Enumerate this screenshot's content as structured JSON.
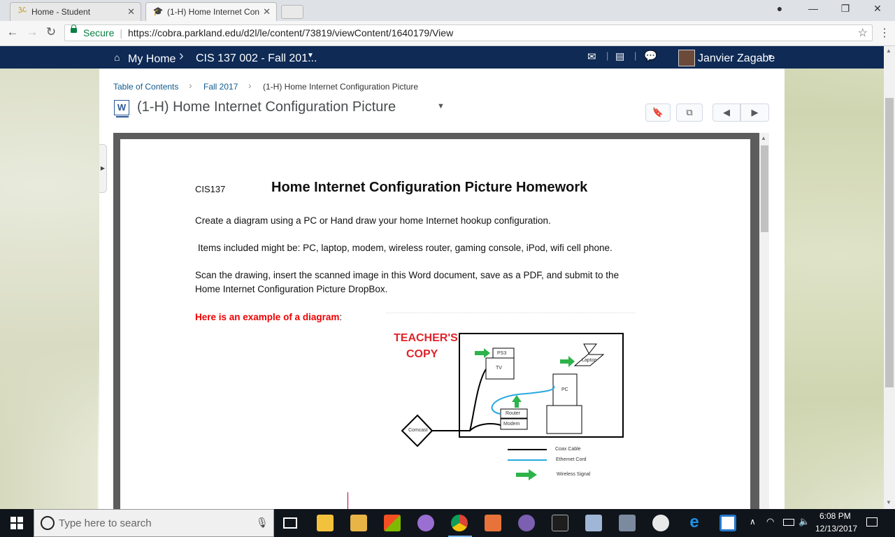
{
  "browser": {
    "tabs": [
      {
        "title": "Home - Student",
        "active": false,
        "favicon": "d2l-logo-icon"
      },
      {
        "title": "(1-H) Home Internet Con",
        "active": true,
        "favicon": "graduation-cap-icon"
      }
    ],
    "secure_label": "Secure",
    "url": "https://cobra.parkland.edu/d2l/le/content/73819/viewContent/1640179/View"
  },
  "navbar": {
    "home": "My Home",
    "course": "CIS 137 002 - Fall 201...",
    "user": "Janvier Zagabe"
  },
  "breadcrumbs": [
    "Table of Contents",
    "Fall 2017",
    "(1-H) Home Internet Configuration Picture"
  ],
  "page": {
    "title": "(1-H) Home Internet Configuration Picture"
  },
  "document": {
    "course": "CIS137",
    "heading": "Home Internet Configuration Picture Homework",
    "para1": "Create a diagram using a PC or Hand draw your home Internet hookup configuration.",
    "para2": "Items included might be: PC, laptop, modem, wireless router, gaming console, iPod, wifi cell phone.",
    "para3_line1": "Scan the drawing, insert the scanned image in this Word document, save as a PDF, and submit to the",
    "para3_line2": "Home Internet Configuration Picture DropBox.",
    "example_label": "Here is an example of a diagram",
    "example_colon": ":",
    "diagram": {
      "teacher_line1": "TEACHER'S",
      "teacher_line2": "COPY",
      "labels": {
        "ps3": "PS3",
        "tv": "TV",
        "laptop": "Laptop",
        "pc": "PC",
        "router": "Router",
        "modem": "Modem",
        "comcast": "Comcast"
      },
      "legend": [
        "Coax Cable",
        "Ethernet Cord",
        "Wireless Signal"
      ],
      "colors": {
        "coax": "#000000",
        "ethernet": "#29a8e0",
        "wireless": "#2db34a",
        "teacher": "#e0242a"
      }
    }
  },
  "taskbar": {
    "search_placeholder": "Type here to search",
    "time": "6:08 PM",
    "date": "12/13/2017"
  }
}
